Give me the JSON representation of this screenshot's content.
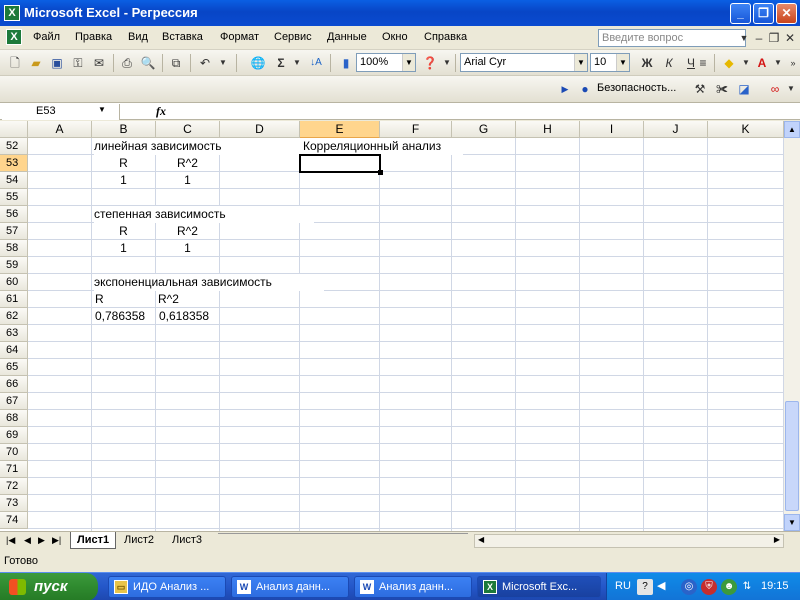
{
  "window": {
    "title": "Microsoft Excel - Регрессия",
    "minimize_label": "_",
    "restore_label": "❐",
    "close_label": "✕"
  },
  "menu": {
    "items": [
      {
        "label": "Файл"
      },
      {
        "label": "Правка"
      },
      {
        "label": "Вид"
      },
      {
        "label": "Вставка"
      },
      {
        "label": "Формат"
      },
      {
        "label": "Сервис"
      },
      {
        "label": "Данные"
      },
      {
        "label": "Окно"
      },
      {
        "label": "Справка"
      }
    ],
    "help_placeholder": "Введите вопрос"
  },
  "toolbar": {
    "zoom": "100%",
    "font_name": "Arial Cyr",
    "font_size": "10",
    "bold_label": "Ж",
    "italic_label": "К",
    "underline_label": "Ч",
    "security_label": "Безопасность..."
  },
  "formula_bar": {
    "name_box": "E53",
    "fx_label": "fx",
    "formula": ""
  },
  "sheet": {
    "columns": [
      "A",
      "B",
      "C",
      "D",
      "E",
      "F",
      "G",
      "H",
      "I",
      "J",
      "K"
    ],
    "selected_column": "E",
    "rows": [
      "52",
      "53",
      "54",
      "55",
      "56",
      "57",
      "58",
      "59",
      "60",
      "61",
      "62",
      "63",
      "64",
      "65",
      "66",
      "67",
      "68",
      "69",
      "70",
      "71",
      "72",
      "73",
      "74"
    ],
    "selected_row": "53",
    "cells": {
      "B52": "линейная зависимость",
      "E52": "Корреляционный анализ",
      "B53": "R",
      "C53": "R^2",
      "B54": "1",
      "C54": "1",
      "B56": "степенная зависимость",
      "B57": "R",
      "C57": "R^2",
      "B58": "1",
      "C58": "1",
      "B60": "экспоненциальная зависимость",
      "B61": "R",
      "C61": "R^2",
      "B62": "0,786358",
      "C62": "0,618358"
    }
  },
  "tabs": {
    "items": [
      {
        "label": "Лист1",
        "active": true
      },
      {
        "label": "Лист2",
        "active": false
      },
      {
        "label": "Лист3",
        "active": false
      }
    ]
  },
  "status": {
    "text": "Готово"
  },
  "taskbar": {
    "start_label": "пуск",
    "tasks": [
      {
        "label": "ИДО Анализ ...",
        "icon": "folder-icon"
      },
      {
        "label": "Анализ данн...",
        "icon": "word-icon"
      },
      {
        "label": "Анализ данн...",
        "icon": "word-icon"
      },
      {
        "label": "Microsoft Exc...",
        "icon": "excel-icon"
      }
    ],
    "language": "RU",
    "clock": "19:15"
  }
}
